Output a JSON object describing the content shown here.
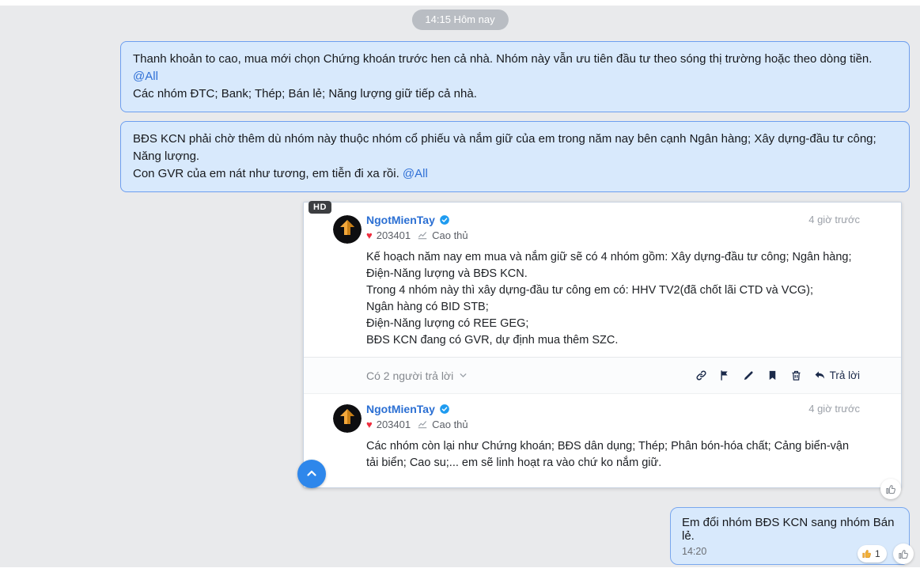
{
  "timeline": {
    "divider_label": "14:15 Hôm nay"
  },
  "incoming_messages": [
    {
      "paragraph1": "Thanh khoản to cao, mua mới chọn Chứng khoán trước hen cả nhà. Nhóm này vẫn ưu tiên đầu tư theo sóng thị trường hoặc theo dòng tiền.",
      "mention": "@All",
      "paragraph2": "Các nhóm ĐTC; Bank; Thép; Bán lẻ; Năng lượng giữ tiếp cả nhà."
    },
    {
      "paragraph1": "BĐS KCN phải chờ thêm dù nhóm này thuộc nhóm cổ phiếu và nắm giữ của em trong năm nay bên cạnh Ngân hàng; Xây dựng-đầu tư công; Năng lượng.",
      "paragraph2": "Con GVR của em nát như tương, em tiễn đi xa rồi. ",
      "mention": "@All"
    }
  ],
  "embed_card": {
    "quality_badge": "HD",
    "posts": [
      {
        "username": "NgotMienTay",
        "likes": "203401",
        "rank": "Cao thủ",
        "timestamp": "4 giờ trước",
        "lines": [
          "Kế hoạch năm nay em mua và nắm giữ sẽ có 4 nhóm gồm: Xây dựng-đầu tư công; Ngân hàng; Điện-Năng lượng và BĐS KCN.",
          "Trong 4 nhóm này thì xây dựng-đầu tư công em có: HHV TV2(đã chốt lãi CTD và VCG);",
          "Ngân hàng có BID STB;",
          "Điện-Năng lượng có REE GEG;",
          "BĐS KCN đang có GVR, dự định mua thêm SZC."
        ]
      },
      {
        "username": "NgotMienTay",
        "likes": "203401",
        "rank": "Cao thủ",
        "timestamp": "4 giờ trước",
        "lines": [
          "Các nhóm còn lại như Chứng khoán; BĐS dân dụng; Thép; Phân bón-hóa chất; Cảng biển-vận tải biển; Cao su;... em sẽ linh hoạt ra vào chứ ko nắm giữ."
        ]
      }
    ],
    "replies_toggle": "Có 2 người trả lời",
    "reply_button": "Trả lời"
  },
  "outgoing_message": {
    "text": "Em đổi nhóm BĐS KCN sang nhóm Bán lẻ.",
    "time": "14:20",
    "reaction_count": "1"
  },
  "icons": {
    "heart_glyph": "♥",
    "verified": "verified-badge-check",
    "rank": "line-chart",
    "replies_chevron": "chevron-down",
    "toolbar": [
      "link",
      "flag",
      "pencil",
      "bookmark",
      "trash",
      "reply-arrow"
    ],
    "scroll_button": "chevron-up",
    "like_button": "thumbs-up-outline",
    "reaction": "thumbs-up-filled",
    "avatar": "gold-up-arrow-logo"
  },
  "colors": {
    "bubble_bg": "#d8e9fc",
    "bubble_border": "#6d9eef",
    "link_blue": "#2e6fd6",
    "username_blue": "#2b6fd3",
    "verified_blue": "#1e9bf0",
    "heart_red": "#ee2d3e",
    "toolbar_navy": "#1b2a4a",
    "scroll_button_blue": "#2e87eb",
    "divider_pill_gray": "#b9bdc3"
  }
}
